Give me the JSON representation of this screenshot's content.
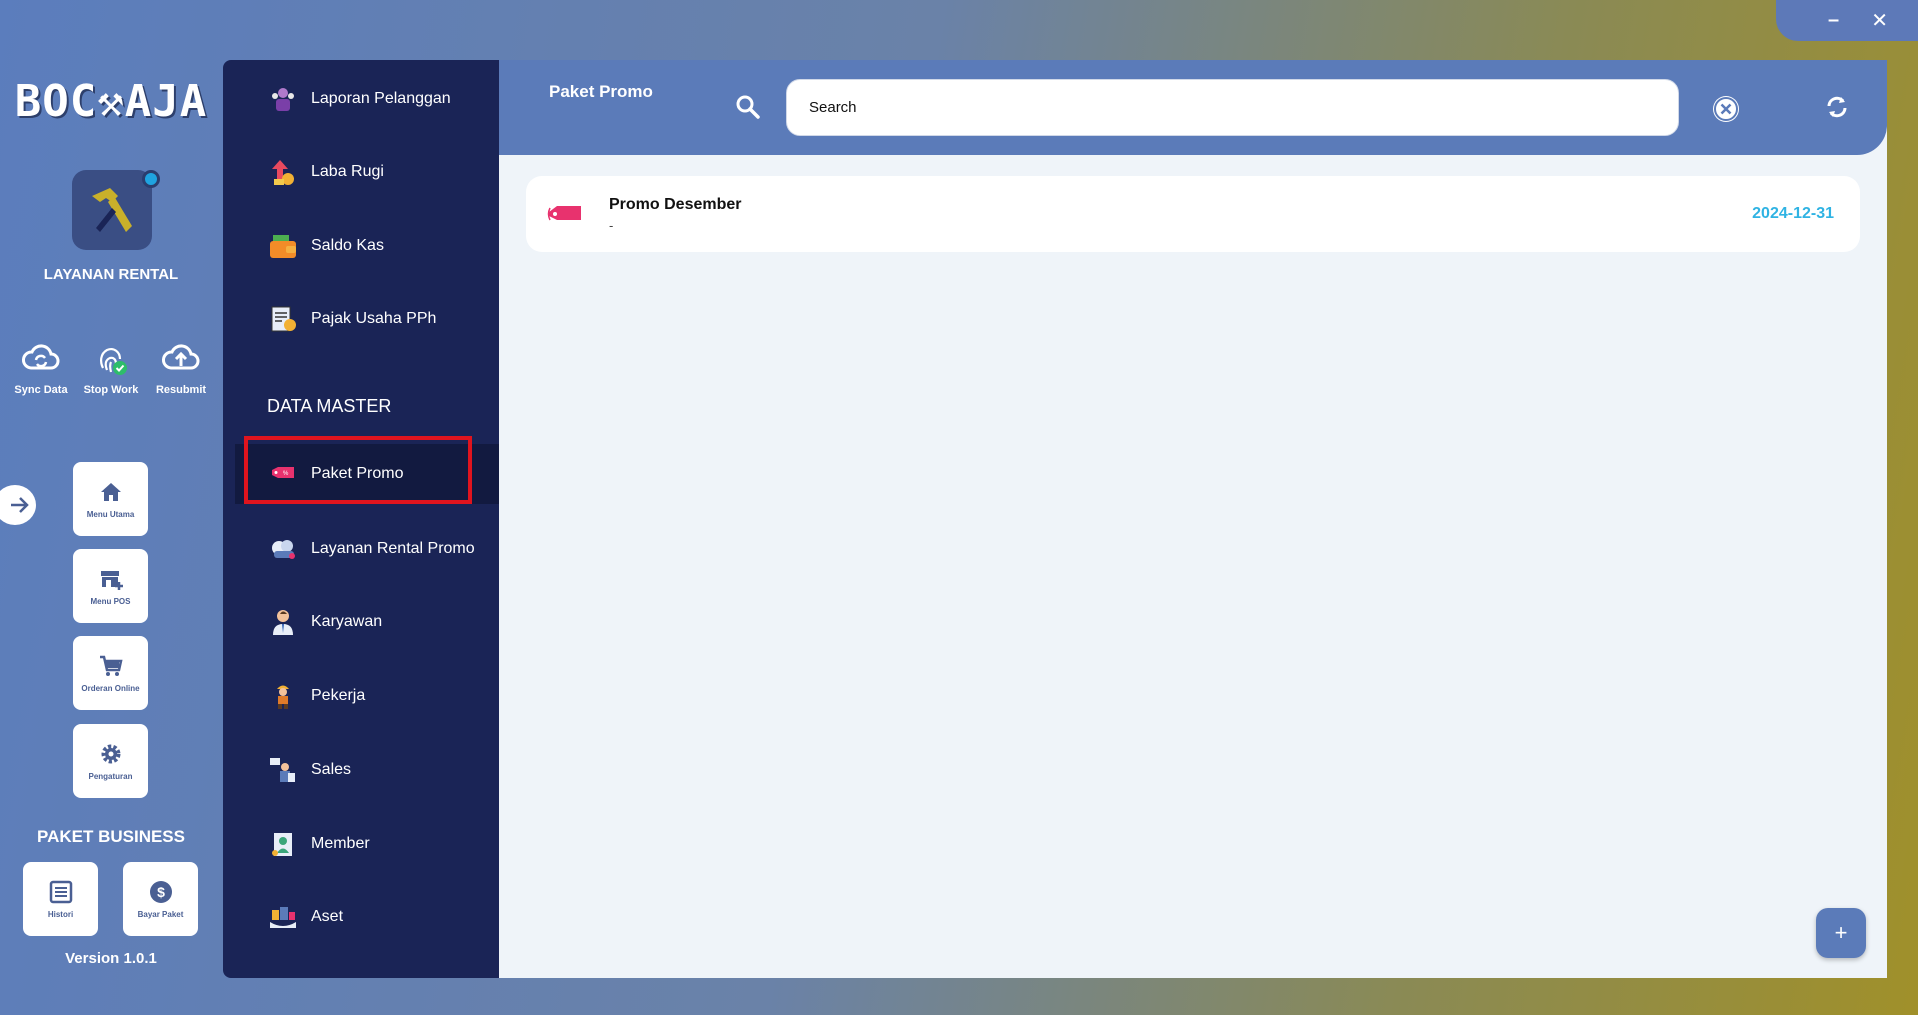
{
  "window": {
    "minimize_label": "–",
    "close_label": "✕"
  },
  "sidebar": {
    "logo_text": "BOC⚒AJA",
    "app_name": "LAYANAN RENTAL",
    "quick_actions": [
      {
        "label": "Sync Data",
        "icon": "cloud-sync-icon"
      },
      {
        "label": "Stop Work",
        "icon": "fingerprint-icon"
      },
      {
        "label": "Resubmit",
        "icon": "cloud-upload-icon"
      }
    ],
    "nav_tiles": [
      {
        "label": "Menu Utama",
        "icon": "home-icon"
      },
      {
        "label": "Menu POS",
        "icon": "store-icon"
      },
      {
        "label": "Orderan Online",
        "icon": "cart-icon"
      },
      {
        "label": "Pengaturan",
        "icon": "gear-icon"
      }
    ],
    "business_title": "PAKET BUSINESS",
    "business_tiles": [
      {
        "label": "Histori",
        "icon": "list-icon"
      },
      {
        "label": "Bayar Paket",
        "icon": "dollar-icon"
      }
    ],
    "version": "Version 1.0.1"
  },
  "menu": {
    "items_top": [
      {
        "label": "Laporan Pelanggan",
        "icon": "customers-report-icon"
      },
      {
        "label": "Laba Rugi",
        "icon": "profit-loss-icon"
      },
      {
        "label": "Saldo Kas",
        "icon": "wallet-icon"
      },
      {
        "label": "Pajak Usaha PPh",
        "icon": "tax-icon"
      }
    ],
    "section_title": "DATA MASTER",
    "items_master": [
      {
        "label": "Paket Promo",
        "icon": "promo-tag-icon",
        "active": true
      },
      {
        "label": "Layanan Rental Promo",
        "icon": "rental-promo-icon"
      },
      {
        "label": "Karyawan",
        "icon": "employee-icon"
      },
      {
        "label": "Pekerja",
        "icon": "worker-icon"
      },
      {
        "label": "Sales",
        "icon": "sales-icon"
      },
      {
        "label": "Member",
        "icon": "member-icon"
      },
      {
        "label": "Aset",
        "icon": "asset-icon"
      }
    ]
  },
  "main": {
    "title": "Paket Promo",
    "search": {
      "placeholder": "Search",
      "value": ""
    },
    "promos": [
      {
        "name": "Promo Desember",
        "description": "-",
        "date": "2024-12-31"
      }
    ],
    "fab_label": "+"
  },
  "colors": {
    "accent": "#5b7bb9",
    "menu_bg": "#1a2456",
    "content_bg": "#eff4f9",
    "date_color": "#2fb3e3",
    "highlight": "#e0141e"
  }
}
